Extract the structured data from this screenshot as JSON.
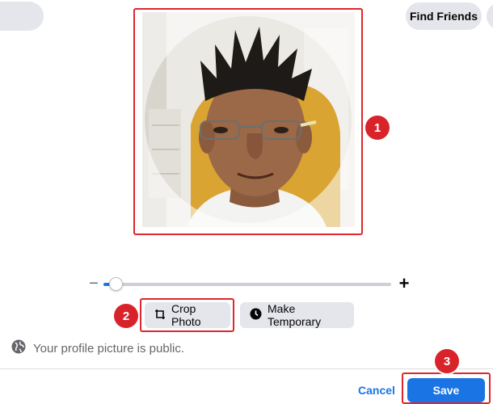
{
  "header": {
    "find_friends_label": "Find Friends"
  },
  "editor": {
    "callouts": [
      "1",
      "2",
      "3"
    ],
    "zoom": {
      "min_symbol": "−",
      "max_symbol": "+",
      "level": 0.03
    },
    "crop_label": "Crop Photo",
    "temporary_label": "Make Temporary",
    "privacy_text": "Your profile picture is public."
  },
  "footer": {
    "cancel_label": "Cancel",
    "save_label": "Save"
  },
  "icons": {
    "crop": "crop-icon",
    "temporary": "clock-icon",
    "privacy": "globe-icon"
  },
  "colors": {
    "accent": "#1b74e4",
    "highlight": "#e0262e",
    "callout": "#d9232b",
    "button_bg": "#e4e6eb"
  }
}
